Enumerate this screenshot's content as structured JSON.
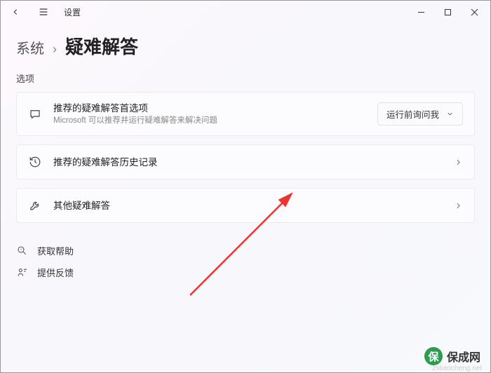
{
  "titlebar": {
    "app_title": "设置"
  },
  "breadcrumb": {
    "parent": "系统",
    "current": "疑难解答"
  },
  "section_label": "选项",
  "cards": {
    "pref": {
      "title": "推荐的疑难解答首选项",
      "subtitle": "Microsoft 可以推荐并运行疑难解答来解决问题",
      "dropdown_value": "运行前询问我"
    },
    "history": {
      "title": "推荐的疑难解答历史记录"
    },
    "other": {
      "title": "其他疑难解答"
    }
  },
  "links": {
    "help": "获取帮助",
    "feedback": "提供反馈"
  },
  "watermark": {
    "brand": "保成网",
    "url": "zsbaocheng.net"
  }
}
